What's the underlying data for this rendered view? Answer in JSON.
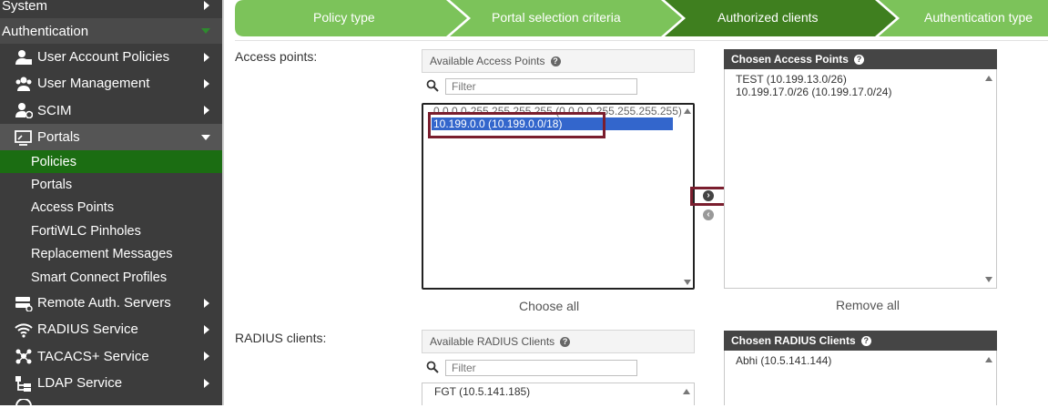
{
  "sidebar": {
    "system": "System",
    "authentication": "Authentication",
    "items": [
      {
        "label": "User Account Policies",
        "icon": "user-lock-icon"
      },
      {
        "label": "User Management",
        "icon": "users-icon"
      },
      {
        "label": "SCIM",
        "icon": "user-sync-icon"
      },
      {
        "label": "Portals",
        "icon": "portal-icon"
      },
      {
        "label": "Remote Auth. Servers",
        "icon": "server-icon"
      },
      {
        "label": "RADIUS Service",
        "icon": "wifi-icon"
      },
      {
        "label": "TACACS+ Service",
        "icon": "network-icon"
      },
      {
        "label": "LDAP Service",
        "icon": "ldap-icon"
      }
    ],
    "subitems": [
      "Policies",
      "Portals",
      "Access Points",
      "FortiWLC Pinholes",
      "Replacement Messages",
      "Smart Connect Profiles"
    ]
  },
  "steps": [
    "Policy type",
    "Portal selection criteria",
    "Authorized clients",
    "Authentication type"
  ],
  "access_points": {
    "label": "Access points:",
    "available_title": "Available Access Points",
    "filter_placeholder": "Filter",
    "available": [
      "0.0.0.0-255.255.255.255 (0.0.0.0-255.255.255.255)",
      "10.199.0.0 (10.199.0.0/18)"
    ],
    "chosen_title": "Chosen Access Points",
    "chosen": [
      "TEST (10.199.13.0/26)",
      "10.199.17.0/26 (10.199.17.0/24)"
    ],
    "choose_all": "Choose all",
    "remove_all": "Remove all"
  },
  "radius_clients": {
    "label": "RADIUS clients:",
    "available_title": "Available RADIUS Clients",
    "filter_placeholder": "Filter",
    "available": [
      "FGT (10.5.141.185)"
    ],
    "chosen_title": "Chosen RADIUS Clients",
    "chosen": [
      "Abhi (10.5.141.144)"
    ]
  },
  "colors": {
    "active_green": "#1b6d12",
    "step_green": "#7cc35a",
    "step_active": "#3f7f1f",
    "selection": "#3366cc",
    "highlight": "#7a1e2e"
  }
}
